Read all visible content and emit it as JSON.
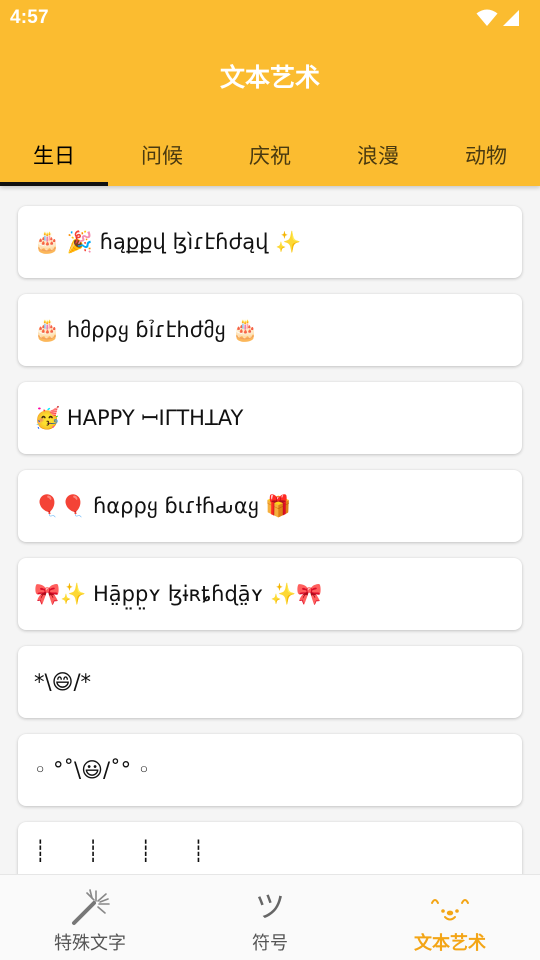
{
  "status_bar": {
    "time": "4:57"
  },
  "app": {
    "title": "文本艺术"
  },
  "tabs": [
    {
      "label": "生日",
      "active": true
    },
    {
      "label": "问候",
      "active": false
    },
    {
      "label": "庆祝",
      "active": false
    },
    {
      "label": "浪漫",
      "active": false
    },
    {
      "label": "动物",
      "active": false
    }
  ],
  "items": [
    "🎂 🎉 ɦąքքվ ɮìɾէɦժąվ ✨",
    "🎂 հმρρყ ɓỉɾէհժმყ 🎂",
    "🥳 HAPPY ꟷIΓTHꓕAY",
    "🎈🎈 ɦαρρყ ɓιɾƚɦԃαყ 🎁",
    "🎀✨ Hā̤p̤p̤ʏ ɮɨʀȶɦɖā̤ʏ ✨🎀",
    "*\\😄/*",
    "◦ °˚\\😃/˚° ◦",
    "┊      ┊      ┊      ┊"
  ],
  "bottom_nav": [
    {
      "label": "特殊文字",
      "icon": "magic-wand-icon",
      "active": false
    },
    {
      "label": "符号",
      "icon": "tsu-icon",
      "glyph": "ツ",
      "active": false
    },
    {
      "label": "文本艺术",
      "icon": "cute-face-icon",
      "active": true
    }
  ],
  "colors": {
    "accent": "#fbbc30",
    "active_nav": "#f3a516"
  }
}
